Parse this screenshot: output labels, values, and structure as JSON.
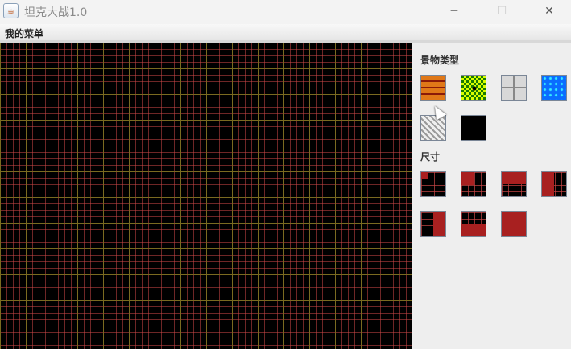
{
  "window": {
    "title": "坦克大战1.0",
    "minimize": "─",
    "maximize": "☐",
    "close": "✕"
  },
  "menu": {
    "label": "我的菜单"
  },
  "panel": {
    "scenery_label": "景物类型",
    "scenery": [
      "brick",
      "grass",
      "steel",
      "water",
      "ice",
      "empty"
    ],
    "size_label": "尺寸",
    "sizes": [
      "1/4 top-left",
      "top-left half",
      "top half",
      "left half",
      "right half",
      "bottom half",
      "full"
    ]
  }
}
